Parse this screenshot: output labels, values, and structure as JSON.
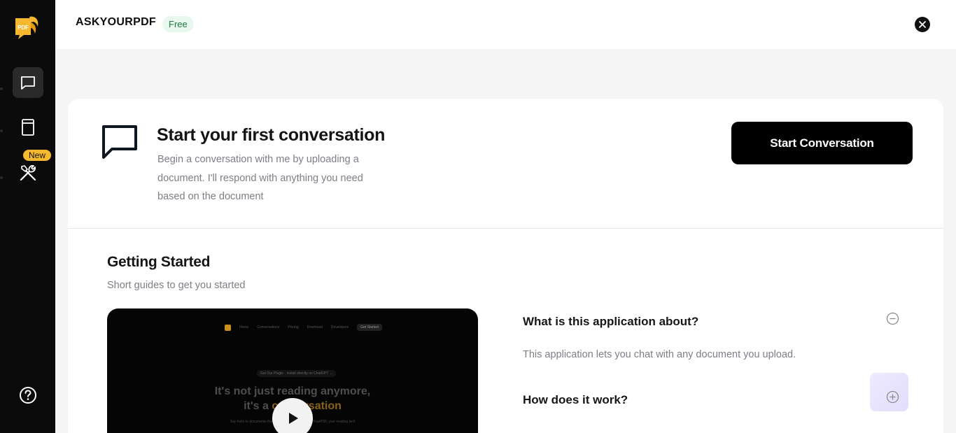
{
  "sidebar": {
    "logo_text": "PDF",
    "items": [
      {
        "name": "chat-icon",
        "active": true
      },
      {
        "name": "book-icon",
        "active": false
      },
      {
        "name": "tools-icon",
        "active": false,
        "badge": "New"
      }
    ],
    "help_icon": "help-icon"
  },
  "header": {
    "brand": "ASKYOURPDF",
    "plan": "Free"
  },
  "hero": {
    "title": "Start your first conversation",
    "description": "Begin a conversation with me by uploading a document. I'll respond with anything you need based on the document",
    "button": "Start Conversation"
  },
  "getting_started": {
    "title": "Getting Started",
    "subtitle": "Short guides to get you started",
    "video": {
      "nav": [
        "Home",
        "Conversations",
        "Pricing",
        "Download",
        "Developers"
      ],
      "nav_cta": "Get Started",
      "pill": "Get Our Plugin · Install directly on ChatGPT →",
      "headline_1": "It's not just reading anymore,",
      "headline_2a": "it's a ",
      "headline_2b": "conversation",
      "small": "Say hello to documents that respond to you! With AskYourPDF, your reading isn't"
    },
    "faq": [
      {
        "question": "What is this application about?",
        "answer": "This application lets you chat with any document you upload.",
        "expanded": true
      },
      {
        "question": "How does it work?",
        "expanded": false
      }
    ]
  },
  "colors": {
    "sidebar": "#0b0b0b",
    "badge_new": "#f5b82e",
    "free_badge_bg": "#e8f8ee",
    "free_badge_text": "#1e7a3e",
    "primary_button": "#000000"
  }
}
